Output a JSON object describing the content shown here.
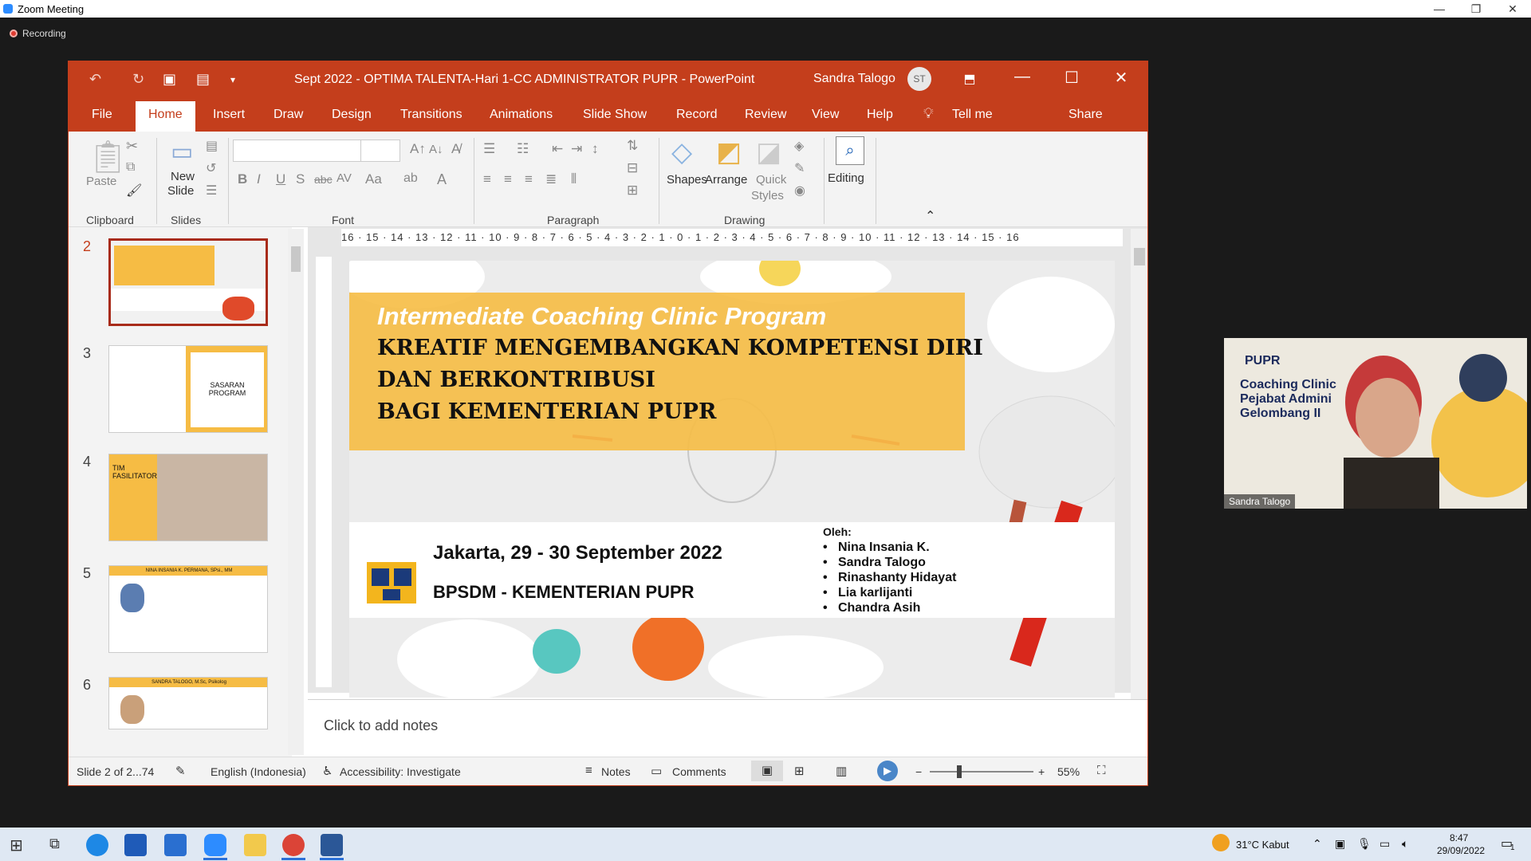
{
  "zoom": {
    "window_title": "Zoom Meeting",
    "recording_label": "Recording",
    "accent_color": "#2D8CFF"
  },
  "ppt": {
    "doc_title": "Sept 2022 - OPTIMA TALENTA-Hari 1-CC ADMINISTRATOR PUPR  -  PowerPoint",
    "user_name": "Sandra Talogo",
    "user_initials": "ST",
    "brand_color": "#C43E1C",
    "tabs": [
      "File",
      "Home",
      "Insert",
      "Draw",
      "Design",
      "Transitions",
      "Animations",
      "Slide Show",
      "Record",
      "Review",
      "View",
      "Help"
    ],
    "tell_me": "Tell me",
    "share": "Share",
    "ribbon": {
      "paste": "Paste",
      "new_slide_1": "New",
      "new_slide_2": "Slide",
      "shapes": "Shapes",
      "arrange": "Arrange",
      "quick_styles_1": "Quick",
      "quick_styles_2": "Styles",
      "editing": "Editing",
      "groups": [
        "Clipboard",
        "Slides",
        "Font",
        "Paragraph",
        "Drawing"
      ]
    },
    "ruler_text": "16 · 15 · 14 · 13 · 12 · 11 · 10 · 9 · 8 · 7 · 6 · 5 · 4 · 3 · 2 · 1 · 0 · 1 · 2 · 3 · 4 · 5 · 6 · 7 · 8 · 9 · 10 · 11 · 12 · 13 · 14 · 15 · 16",
    "thumbnails": [
      {
        "num": "2",
        "selected": true
      },
      {
        "num": "3",
        "label": "SASARAN PROGRAM"
      },
      {
        "num": "4",
        "label": "TIM FASILITATOR"
      },
      {
        "num": "5",
        "label": "NINA INSANIA K. PERMANA, SPsi., MM"
      },
      {
        "num": "6",
        "label": "SANDRA TALOGO, M.Sc, Psikolog"
      }
    ],
    "slide": {
      "subtitle": "Intermediate Coaching Clinic Program",
      "headline_lines": [
        "KREATIF MENGEMBANGKAN KOMPETENSI DIRI",
        "DAN BERKONTRIBUSI",
        "BAGI KEMENTERIAN PUPR"
      ],
      "place_date": "Jakarta, 29 - 30 September 2022",
      "organization": "BPSDM  -  KEMENTERIAN PUPR",
      "by_label": "Oleh:",
      "presenters": [
        "Nina Insania K.",
        "Sandra Talogo",
        "Rinashanty Hidayat",
        "Lia karlijanti",
        "Chandra Asih"
      ]
    },
    "notes_placeholder": "Click to add notes",
    "status": {
      "slide_count": "Slide 2 of 2...74",
      "language": "English (Indonesia)",
      "accessibility": "Accessibility: Investigate",
      "notes": "Notes",
      "comments": "Comments",
      "zoom_level": "55%"
    }
  },
  "video_tile": {
    "participant": "Sandra Talogo",
    "logo_text": "PUPR",
    "title_lines": [
      "Coaching Clinic",
      "Pejabat Admini",
      "Gelombang II"
    ]
  },
  "taskbar": {
    "weather": "31°C  Kabut",
    "time": "8:47",
    "date": "29/09/2022",
    "notification_count": "1"
  }
}
